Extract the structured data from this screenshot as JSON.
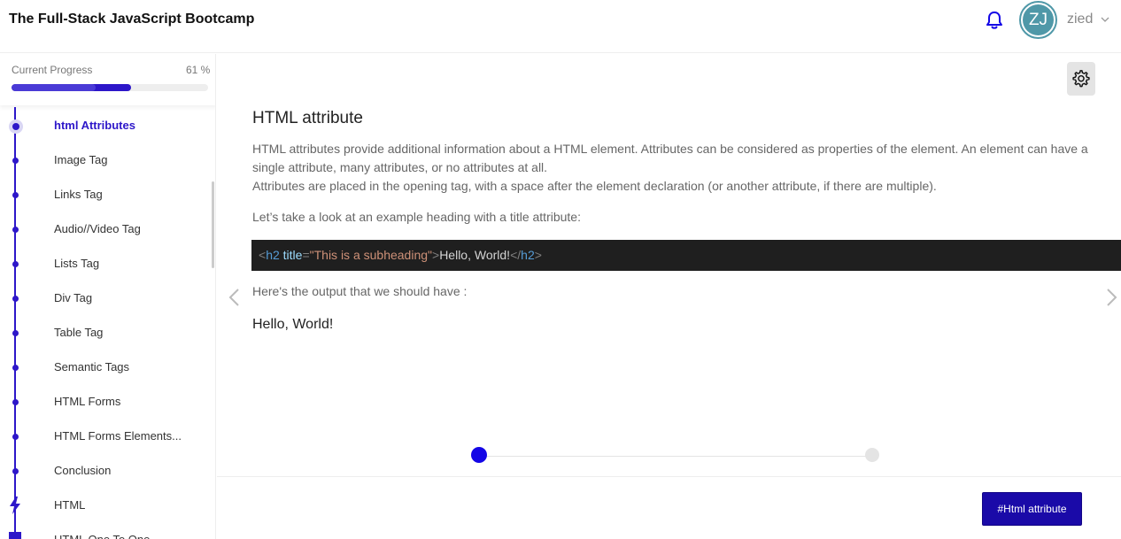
{
  "header": {
    "title": "The Full-Stack JavaScript Bootcamp",
    "notification_icon": "bell-icon",
    "avatar_initials": "ZJ",
    "username": "zied",
    "user_menu_icon": "chevron-down-icon"
  },
  "progress": {
    "label": "Current Progress",
    "value_text": "61 %",
    "fraction": 0.61
  },
  "sidebar": {
    "lessons": [
      {
        "label": "html Attributes",
        "active": true
      },
      {
        "label": "Image Tag"
      },
      {
        "label": "Links Tag"
      },
      {
        "label": "Audio//Video Tag"
      },
      {
        "label": "Lists Tag"
      },
      {
        "label": "Div Tag"
      },
      {
        "label": "Table Tag"
      },
      {
        "label": "Semantic Tags"
      },
      {
        "label": "HTML Forms"
      },
      {
        "label": "HTML Forms Elements..."
      },
      {
        "label": "Conclusion"
      },
      {
        "label": "HTML",
        "icon": "bolt-icon"
      },
      {
        "label": "HTML One To One",
        "icon": "square-icon"
      }
    ]
  },
  "lesson": {
    "title": "HTML attribute",
    "paragraph1": "HTML attributes provide additional information about a HTML element. Attributes can be considered as properties of the element. An element can have a single attribute, many attributes, or no attributes at all.",
    "paragraph2": "Attributes are placed in the opening tag, with a space after the element declaration (or another attribute, if there are multiple).",
    "paragraph3": "Let’s take a look at an example heading with a title attribute:",
    "code": {
      "open_bracket": "<",
      "tag": "h2",
      "space": " ",
      "attr": "title",
      "equals": "=",
      "attr_value": "\"This is a subheading\"",
      "close_open": ">",
      "text": "Hello, World!",
      "close_start": "</",
      "close_tag": "h2",
      "close_end": ">"
    },
    "output_label": "Here's the output that we should have :",
    "output_sample": "Hello, World!"
  },
  "controls": {
    "settings_icon": "gear-icon",
    "prev_icon": "chevron-left-icon",
    "next_icon": "chevron-right-icon",
    "tag_button_label": "#Html attribute"
  },
  "colors": {
    "accent": "#2d17c9",
    "button": "#1a0aa8",
    "step_active": "#1406e6",
    "code_bg": "#1f1f1f"
  }
}
